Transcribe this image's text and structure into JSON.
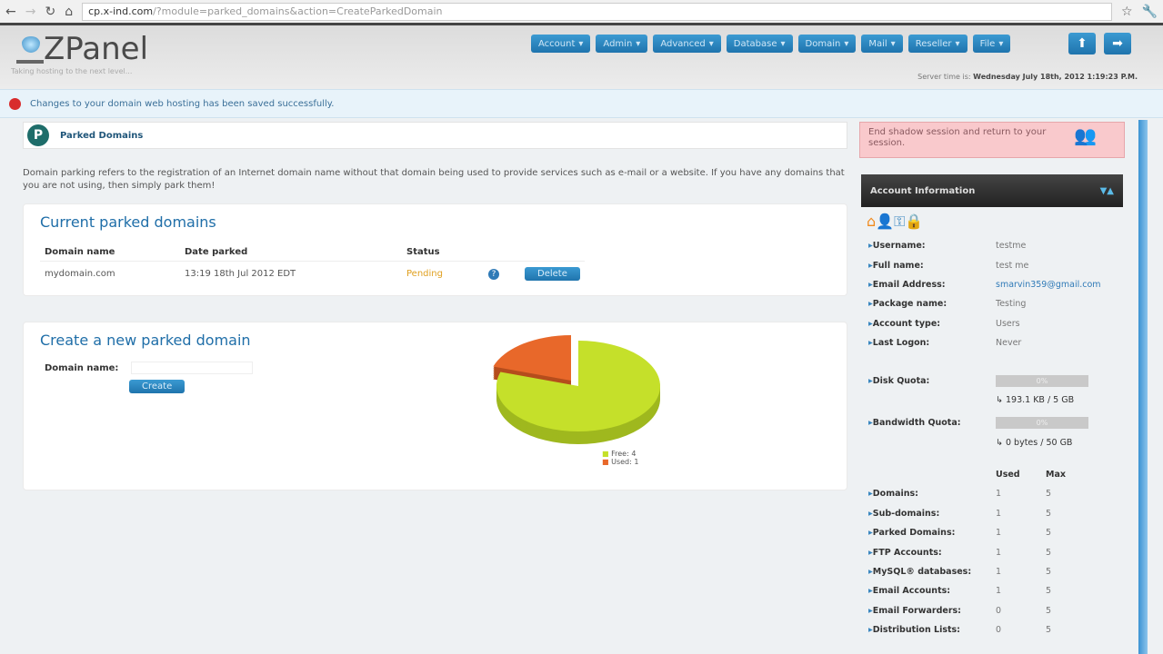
{
  "browser": {
    "url_host": "cp.x-ind.com",
    "url_path": "/?module=parked_domains&action=CreateParkedDomain"
  },
  "header": {
    "logo": "ZPanel",
    "tagline": "Taking hosting to the next level...",
    "menu": [
      "Account",
      "Admin",
      "Advanced",
      "Database",
      "Domain",
      "Mail",
      "Reseller",
      "File"
    ],
    "server_time_label": "Server time is:",
    "server_time": "Wednesday July 18th, 2012 1:19:23 P.M."
  },
  "notice": "Changes to your domain web hosting has been saved successfully.",
  "module": {
    "title": "Parked Domains",
    "description": "Domain parking refers to the registration of an Internet domain name without that domain being used to provide services such as e-mail or a website. If you have any domains that you are not using, then simply park them!"
  },
  "current": {
    "heading": "Current parked domains",
    "columns": [
      "Domain name",
      "Date parked",
      "Status"
    ],
    "rows": [
      {
        "domain": "mydomain.com",
        "date": "13:19 18th Jul 2012 EDT",
        "status": "Pending",
        "action": "Delete"
      }
    ]
  },
  "create": {
    "heading": "Create a new parked domain",
    "label": "Domain name:",
    "value": "",
    "button": "Create"
  },
  "chart_data": {
    "type": "pie",
    "categories": [
      "Free",
      "Used"
    ],
    "values": [
      4,
      1
    ],
    "colors": [
      "#c5e02a",
      "#e8682a"
    ],
    "legend": [
      "Free: 4",
      "Used: 1"
    ]
  },
  "side": {
    "shadow": "End shadow session and return to your session.",
    "account_title": "Account Information",
    "info": [
      {
        "k": "Username:",
        "v": "testme"
      },
      {
        "k": "Full name:",
        "v": "test me"
      },
      {
        "k": "Email Address:",
        "v": "smarvin359@gmail.com"
      },
      {
        "k": "Package name:",
        "v": "Testing"
      },
      {
        "k": "Account type:",
        "v": "Users"
      },
      {
        "k": "Last Logon:",
        "v": "Never"
      }
    ],
    "disk": {
      "label": "Disk Quota:",
      "percent": "0%",
      "usage": "↳ 193.1 KB / 5 GB"
    },
    "bandwidth": {
      "label": "Bandwidth Quota:",
      "percent": "0%",
      "usage": "↳ 0 bytes / 50 GB"
    },
    "usage_headers": [
      "Used",
      "Max"
    ],
    "usage": [
      {
        "k": "Domains:",
        "u": "1",
        "m": "5"
      },
      {
        "k": "Sub-domains:",
        "u": "1",
        "m": "5"
      },
      {
        "k": "Parked Domains:",
        "u": "1",
        "m": "5"
      },
      {
        "k": "FTP Accounts:",
        "u": "1",
        "m": "5"
      },
      {
        "k": "MySQL® databases:",
        "u": "1",
        "m": "5"
      },
      {
        "k": "Email Accounts:",
        "u": "1",
        "m": "5"
      },
      {
        "k": "Email Forwarders:",
        "u": "0",
        "m": "5"
      },
      {
        "k": "Distribution Lists:",
        "u": "0",
        "m": "5"
      }
    ]
  }
}
